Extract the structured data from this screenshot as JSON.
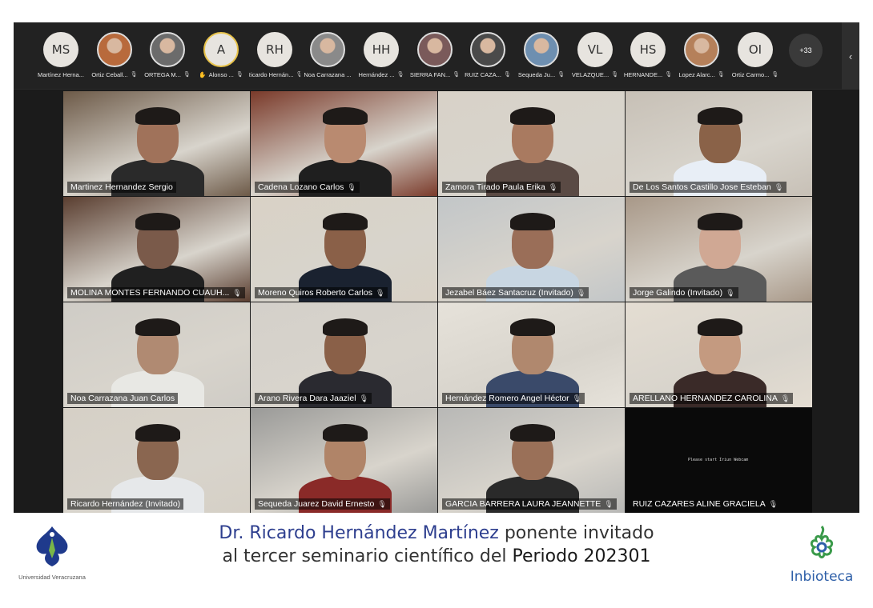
{
  "participants_bar": [
    {
      "initials": "MS",
      "name": "Martínez Herna...",
      "type": "initials",
      "mic": false
    },
    {
      "initials": "",
      "name": "Ortiz Ceball...",
      "type": "photo",
      "color": "#b86a3c",
      "mic": true
    },
    {
      "initials": "",
      "name": "ORTEGA M...",
      "type": "photo",
      "color": "#6b6b6b",
      "mic": true
    },
    {
      "initials": "A",
      "name": "Alonso ...",
      "type": "raised",
      "hand": true,
      "mic": true
    },
    {
      "initials": "RH",
      "name": "Ricardo Hernán...",
      "type": "initials",
      "mic": true
    },
    {
      "initials": "",
      "name": "Noa Carrazana ...",
      "type": "photo",
      "color": "#8a8a8a",
      "mic": false
    },
    {
      "initials": "HH",
      "name": "Hernández ...",
      "type": "initials",
      "mic": true
    },
    {
      "initials": "",
      "name": "SIERRA FAN...",
      "type": "photo",
      "color": "#7a5a5a",
      "mic": true
    },
    {
      "initials": "",
      "name": "RUIZ CAZA...",
      "type": "photo",
      "color": "#4a4a4a",
      "mic": true
    },
    {
      "initials": "",
      "name": "Sequeda Ju...",
      "type": "photo",
      "color": "#6e8fb0",
      "mic": true
    },
    {
      "initials": "VL",
      "name": "VELAZQUE...",
      "type": "initials",
      "mic": true
    },
    {
      "initials": "HS",
      "name": "HERNANDE...",
      "type": "initials",
      "mic": true
    },
    {
      "initials": "",
      "name": "Lopez Alarc...",
      "type": "photo",
      "color": "#b5805a",
      "mic": true
    },
    {
      "initials": "OI",
      "name": "Ortiz Carmo...",
      "type": "initials",
      "mic": true
    }
  ],
  "more_count": "+33",
  "tiles": [
    {
      "name": "Martinez Hernandez Sergio",
      "mic": false,
      "bg": "#6d5a48",
      "skin": "#a0725a",
      "shirt": "#2a2a2a"
    },
    {
      "name": "Cadena Lozano Carlos",
      "mic": true,
      "bg": "#7a3a2a",
      "skin": "#b98a70",
      "shirt": "#1f1f1f"
    },
    {
      "name": "Zamora Tirado Paula Erika",
      "mic": true,
      "bg": "#d8d2c8",
      "skin": "#a97a60",
      "shirt": "#5a4a44"
    },
    {
      "name": "De Los Santos Castillo Jose Esteban",
      "mic": true,
      "bg": "#c7c0b6",
      "skin": "#8a6248",
      "shirt": "#e8eef6"
    },
    {
      "name": "MOLINA MONTES FERNANDO CUAUH...",
      "mic": true,
      "bg": "#5a3e30",
      "skin": "#7a5a4a",
      "shirt": "#202020"
    },
    {
      "name": "Moreno Quiros Roberto Carlos",
      "mic": true,
      "bg": "#d9d2c6",
      "skin": "#8a6048",
      "shirt": "#1a2230"
    },
    {
      "name": "Jezabel Báez Santacruz (Invitado)",
      "mic": true,
      "bg": "#c2c6c8",
      "skin": "#9a6e58",
      "shirt": "#c8d6e2"
    },
    {
      "name": "Jorge Galindo (Invitado)",
      "mic": true,
      "bg": "#a89888",
      "skin": "#d0a894",
      "shirt": "#5a5a5a"
    },
    {
      "name": "Noa Carrazana Juan Carlos",
      "mic": false,
      "bg": "#cfccc6",
      "skin": "#b08a72",
      "shirt": "#e8e8e4"
    },
    {
      "name": "Arano Rivera Dara Jaaziel",
      "mic": true,
      "bg": "#d4d0ca",
      "skin": "#8a6048",
      "shirt": "#2a2a30"
    },
    {
      "name": "Hernández Romero Angel Héctor",
      "mic": true,
      "bg": "#e6e2da",
      "skin": "#b0886e",
      "shirt": "#3a4a6a"
    },
    {
      "name": "ARELLANO HERNANDEZ CAROLINA",
      "mic": true,
      "bg": "#e4ddd2",
      "skin": "#c49a80",
      "shirt": "#3a2a28"
    },
    {
      "name": "Ricardo Hernández (Invitado)",
      "mic": false,
      "bg": "#d6d0c6",
      "skin": "#8a6650",
      "shirt": "#e6e8ea"
    },
    {
      "name": "Sequeda Juarez David Ernesto",
      "mic": true,
      "bg": "#9a9a98",
      "skin": "#b08468",
      "shirt": "#8a2a28"
    },
    {
      "name": "GARCIA BARRERA LAURA JEANNETTE",
      "mic": true,
      "bg": "#b8b8b6",
      "skin": "#9a7058",
      "shirt": "#2a2a2a"
    },
    {
      "name": "RUIZ CAZARES ALINE GRACIELA",
      "mic": true,
      "nocam": true,
      "nocam_text": "Please start Iriun Webcam"
    }
  ],
  "caption": {
    "name": "Dr. Ricardo Hernández Martínez",
    "line1_rest": " ponente invitado",
    "line2_start": "al tercer seminario científico del ",
    "period": "Periodo 202301"
  },
  "logos": {
    "uv_text": "Universidad Veracruzana",
    "inb_text": "Inbioteca"
  },
  "colors": {
    "caption_name": "#2e3f8f",
    "uv_blue": "#1f3a8c",
    "inb_green": "#3a9a4a",
    "inb_blue": "#2e5fa8"
  }
}
